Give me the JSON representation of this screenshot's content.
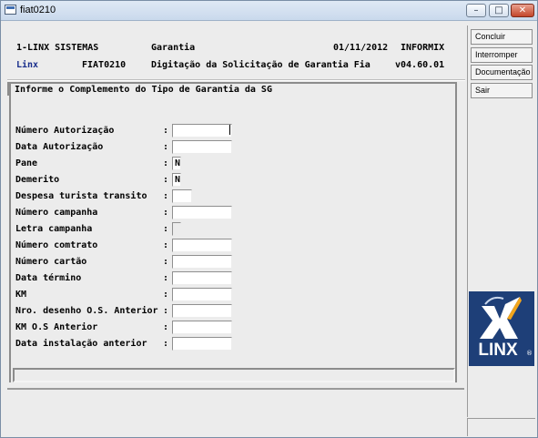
{
  "window": {
    "title": "fiat0210",
    "minimize_glyph": "–",
    "maximize_glyph": "□",
    "close_glyph": "✕"
  },
  "header": {
    "company": "1-LINX SISTEMAS",
    "module": "Garantia",
    "date": "01/11/2012",
    "db": "INFORMIX",
    "system": "Linx",
    "program": "FIAT0210",
    "screen_title": "Digitação da Solicitação de Garantia Fia",
    "version": "v04.60.01"
  },
  "form": {
    "section_title": "Informe o Complemento do Tipo de Garantia da SG",
    "colon": ":",
    "fields": [
      {
        "label": "Número Autorização",
        "value": ""
      },
      {
        "label": "Data Autorização",
        "value": ""
      },
      {
        "label": "Pane",
        "value": "N"
      },
      {
        "label": "Demerito",
        "value": "N"
      },
      {
        "label": "Despesa turista transito",
        "value": ""
      },
      {
        "label": "Número campanha",
        "value": ""
      },
      {
        "label": "Letra campanha",
        "value": ""
      },
      {
        "label": "Número comtrato",
        "value": ""
      },
      {
        "label": "Número cartão",
        "value": ""
      },
      {
        "label": "Data término",
        "value": ""
      },
      {
        "label": "KM",
        "value": ""
      },
      {
        "label": "Nro. desenho O.S. Anterior",
        "value": ""
      },
      {
        "label": "KM O.S Anterior",
        "value": ""
      },
      {
        "label": "Data instalação anterior",
        "value": ""
      }
    ]
  },
  "side_buttons": [
    "Concluir",
    "Interromper",
    "Documentação",
    "Sair"
  ],
  "logo": {
    "text": "LINX",
    "reg": "®"
  },
  "colors": {
    "header_blue": "#1a2f8c",
    "logo_bg": "#1e3f78",
    "logo_orange": "#f2a51c"
  }
}
